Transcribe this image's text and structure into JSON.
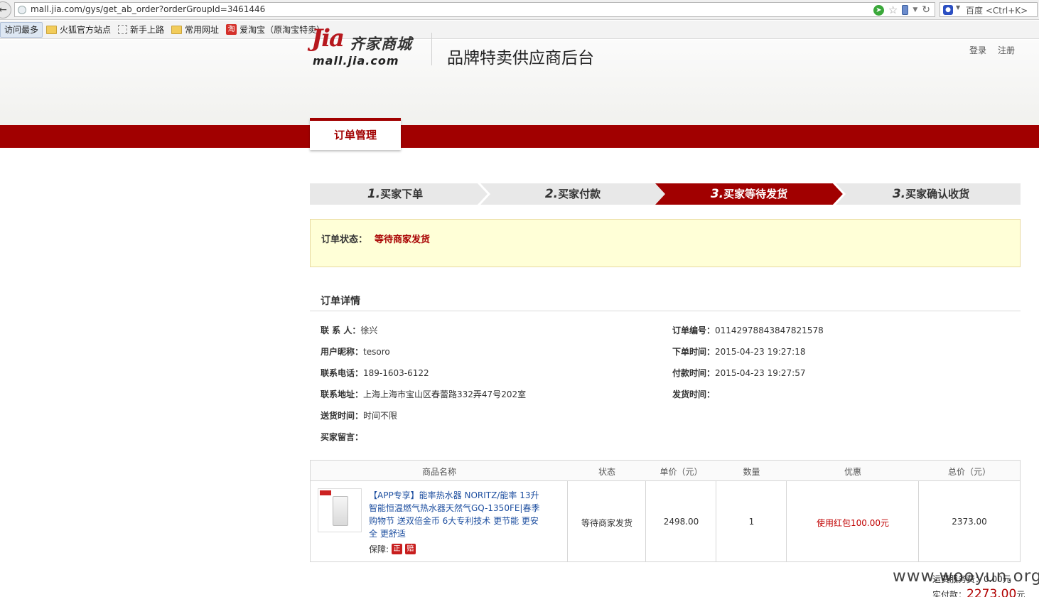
{
  "browser": {
    "url": "mall.jia.com/gys/get_ab_order?orderGroupId=3461446",
    "search_placeholder": "百度 <Ctrl+K>",
    "bookmarks": [
      "访问最多",
      "火狐官方站点",
      "新手上路",
      "常用网址",
      "爱淘宝（原淘宝特卖）"
    ],
    "taobao_glyph": "淘"
  },
  "header": {
    "login": "登录",
    "register": "注册",
    "logo_ji": "Jia",
    "logo_cn": "齐家商城",
    "logo_url": "mall.jia.com",
    "system_title": "品牌特卖供应商后台",
    "nav_tab": "订单管理"
  },
  "steps": [
    {
      "num": "1.",
      "label": "买家下单",
      "active": false
    },
    {
      "num": "2.",
      "label": "买家付款",
      "active": false
    },
    {
      "num": "3.",
      "label": "买家等待发货",
      "active": true
    },
    {
      "num": "3.",
      "label": "买家确认收货",
      "active": false
    }
  ],
  "status": {
    "label": "订单状态：",
    "value": "等待商家发货"
  },
  "details": {
    "title": "订单详情",
    "left": [
      {
        "label": "联 系 人：",
        "value": "徐兴"
      },
      {
        "label": "用户昵称：",
        "value": "tesoro"
      },
      {
        "label": "联系电话：",
        "value": "189-1603-6122"
      },
      {
        "label": "联系地址：",
        "value": "上海上海市宝山区春蕾路332弄47号202室"
      },
      {
        "label": "送货时间：",
        "value": "时间不限"
      },
      {
        "label": "买家留言：",
        "value": ""
      }
    ],
    "right": [
      {
        "label": "订单编号：",
        "value": "01142978843847821578"
      },
      {
        "label": "下单时间：",
        "value": "2015-04-23 19:27:18"
      },
      {
        "label": "付款时间：",
        "value": "2015-04-23 19:27:57"
      },
      {
        "label": "发货时间：",
        "value": ""
      }
    ]
  },
  "table": {
    "headers": [
      "商品名称",
      "状态",
      "单价（元）",
      "数量",
      "优惠",
      "总价（元）"
    ],
    "row": {
      "name": "【APP专享】能率热水器 NORITZ/能率 13升智能恒温燃气热水器天然气GQ-1350FE|春季购物节 送双倍金币 6大专利技术 更节能 更安全 更舒适",
      "guarantee_label": "保障:",
      "badge1": "正",
      "badge2": "赔",
      "status": "等待商家发货",
      "unit_price": "2498.00",
      "quantity": "1",
      "discount": "使用红包100.00元",
      "total": "2373.00"
    }
  },
  "summary": {
    "fee_label": "运费服务费：",
    "fee_value": "0.00元",
    "paid_label": "实付款：",
    "paid_value": "2273.00",
    "paid_unit": "元"
  },
  "watermark": "www.wooyun.org",
  "colors": {
    "brand_red": "#a10000",
    "status_bg": "#ffffd7",
    "link_blue": "#1e4fa0"
  }
}
